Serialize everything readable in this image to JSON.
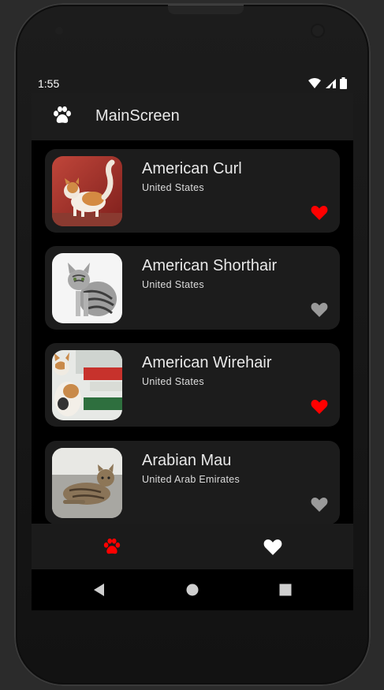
{
  "status_bar": {
    "time": "1:55"
  },
  "app_bar": {
    "title": "MainScreen",
    "icon": "paw-icon"
  },
  "colors": {
    "favorite_on": "#ff0000",
    "favorite_off": "#9a9a9a",
    "card_bg": "#1c1c1c",
    "accent": "#ff0000"
  },
  "breeds": [
    {
      "name": "American Curl",
      "origin": "United States",
      "favorite": true
    },
    {
      "name": "American Shorthair",
      "origin": "United States",
      "favorite": false
    },
    {
      "name": "American Wirehair",
      "origin": "United States",
      "favorite": true
    },
    {
      "name": "Arabian Mau",
      "origin": "United Arab Emirates",
      "favorite": false
    }
  ],
  "bottom_nav": [
    {
      "icon": "paw-icon",
      "selected": true
    },
    {
      "icon": "heart-icon",
      "selected": false
    }
  ],
  "system_nav": [
    {
      "icon": "back-icon"
    },
    {
      "icon": "home-icon"
    },
    {
      "icon": "recents-icon"
    }
  ]
}
